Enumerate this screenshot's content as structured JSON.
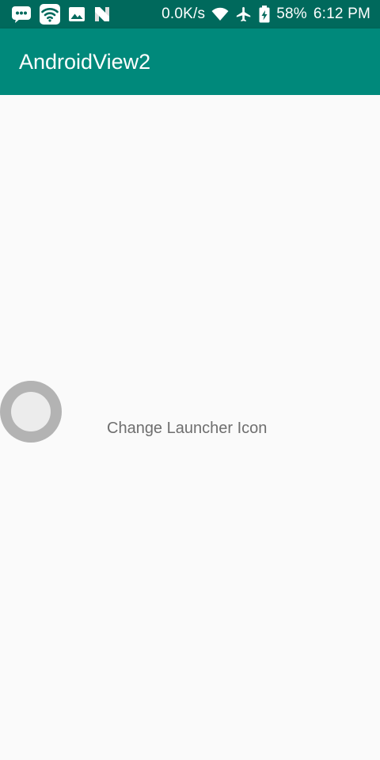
{
  "status_bar": {
    "notification_icons": [
      "messages-icon",
      "wifi-notification-icon",
      "image-icon",
      "n-app-icon"
    ],
    "network_speed": "0.0K/s",
    "battery_percent": "58%",
    "time": "6:12 PM",
    "background_color": "#00695c"
  },
  "app_bar": {
    "title": "AndroidView2",
    "background_color": "#00897b"
  },
  "main": {
    "switch_label": "Change Launcher Icon",
    "switch_checked": false
  }
}
